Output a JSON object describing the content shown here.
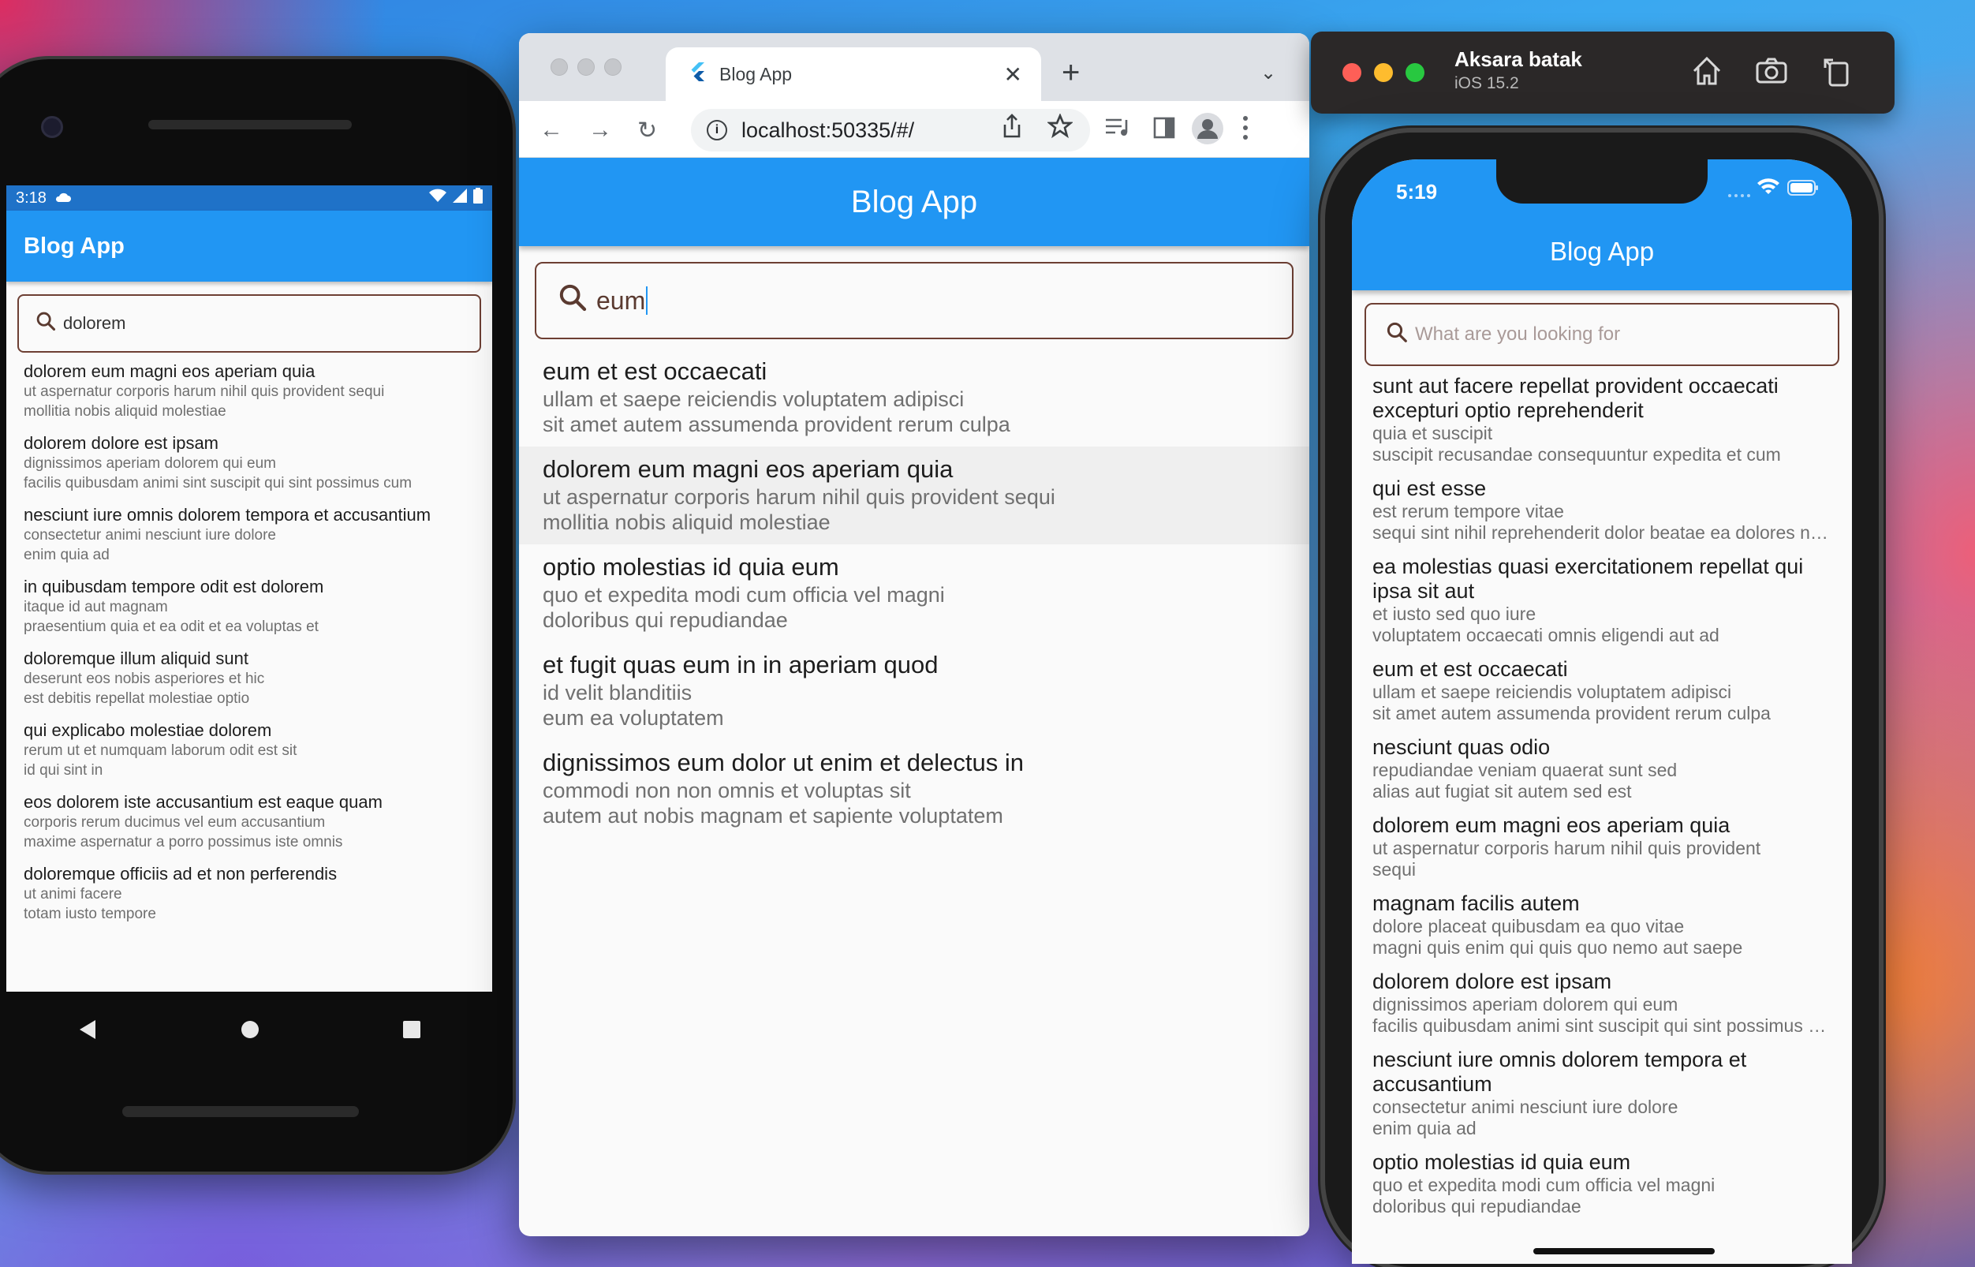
{
  "android": {
    "status_time": "3:18",
    "app_title": "Blog App",
    "search_value": "dolorem",
    "items": [
      {
        "title": "dolorem eum magni eos aperiam quia",
        "line1": "ut aspernatur corporis harum nihil quis provident sequi",
        "line2": "mollitia nobis aliquid molestiae"
      },
      {
        "title": "dolorem dolore est ipsam",
        "line1": "dignissimos aperiam dolorem qui eum",
        "line2": "facilis quibusdam animi sint suscipit qui sint possimus cum"
      },
      {
        "title": "nesciunt iure omnis dolorem tempora et accusantium",
        "line1": "consectetur animi nesciunt iure dolore",
        "line2": "enim quia ad"
      },
      {
        "title": "in quibusdam tempore odit est dolorem",
        "line1": "itaque id aut magnam",
        "line2": "praesentium quia et ea odit et ea voluptas et"
      },
      {
        "title": "doloremque illum aliquid sunt",
        "line1": "deserunt eos nobis asperiores et hic",
        "line2": "est debitis repellat molestiae optio"
      },
      {
        "title": "qui explicabo molestiae dolorem",
        "line1": "rerum ut et numquam laborum odit est sit",
        "line2": "id qui sint in"
      },
      {
        "title": "eos dolorem iste accusantium est eaque quam",
        "line1": "corporis rerum ducimus vel eum accusantium",
        "line2": "maxime aspernatur a porro possimus iste omnis"
      },
      {
        "title": "doloremque officiis ad et non perferendis",
        "line1": "ut animi facere",
        "line2": "totam iusto tempore"
      }
    ]
  },
  "browser": {
    "tab_title": "Blog App",
    "url": "localhost:50335/#/",
    "app_title": "Blog App",
    "search_value": "eum",
    "items": [
      {
        "title": "eum et est occaecati",
        "line1": "ullam et saepe reiciendis voluptatem adipisci",
        "line2": "sit amet autem assumenda provident rerum culpa"
      },
      {
        "title": "dolorem eum magni eos aperiam quia",
        "line1": "ut aspernatur corporis harum nihil quis provident sequi",
        "line2": "mollitia nobis aliquid molestiae"
      },
      {
        "title": "optio molestias id quia eum",
        "line1": "quo et expedita modi cum officia vel magni",
        "line2": "doloribus qui repudiandae"
      },
      {
        "title": "et fugit quas eum in in aperiam quod",
        "line1": "id velit blanditiis",
        "line2": "eum ea voluptatem"
      },
      {
        "title": "dignissimos eum dolor ut enim et delectus in",
        "line1": "commodi non non omnis et voluptas sit",
        "line2": "autem aut nobis magnam et sapiente voluptatem"
      }
    ]
  },
  "simulator": {
    "device_name": "Aksara batak",
    "os_version": "iOS 15.2"
  },
  "ios": {
    "status_time": "5:19",
    "app_title": "Blog App",
    "search_placeholder": "What are you looking for",
    "items": [
      {
        "title": "sunt aut facere repellat provident occaecati excepturi optio reprehenderit",
        "line1": "quia et suscipit",
        "line2": "suscipit recusandae consequuntur expedita et cum"
      },
      {
        "title": "qui est esse",
        "line1": "est rerum tempore vitae",
        "line2": "sequi sint nihil reprehenderit dolor beatae ea dolores neque"
      },
      {
        "title": "ea molestias quasi exercitationem repellat qui ipsa sit aut",
        "line1": "et iusto sed quo iure",
        "line2": "voluptatem occaecati omnis eligendi aut ad"
      },
      {
        "title": "eum et est occaecati",
        "line1": "ullam et saepe reiciendis voluptatem adipisci",
        "line2": "sit amet autem assumenda provident rerum culpa"
      },
      {
        "title": "nesciunt quas odio",
        "line1": "repudiandae veniam quaerat sunt sed",
        "line2": "alias aut fugiat sit autem sed est"
      },
      {
        "title": "dolorem eum magni eos aperiam quia",
        "line1": "ut aspernatur corporis harum nihil quis provident",
        "line2": "sequi"
      },
      {
        "title": "magnam facilis autem",
        "line1": "dolore placeat quibusdam ea quo vitae",
        "line2": "magni quis enim qui quis quo nemo aut saepe"
      },
      {
        "title": "dolorem dolore est ipsam",
        "line1": "dignissimos aperiam dolorem qui eum",
        "line2": "facilis quibusdam animi sint suscipit qui sint possimus cum"
      },
      {
        "title": "nesciunt iure omnis dolorem tempora et accusantium",
        "line1": "consectetur animi nesciunt iure dolore",
        "line2": "enim quia ad"
      },
      {
        "title": "optio molestias id quia eum",
        "line1": "quo et expedita modi cum officia vel magni",
        "line2": "doloribus qui repudiandae"
      }
    ]
  },
  "colors": {
    "app_bar": "#2196f3",
    "search_border": "#6d3f33",
    "android_status": "#1f72c8"
  }
}
